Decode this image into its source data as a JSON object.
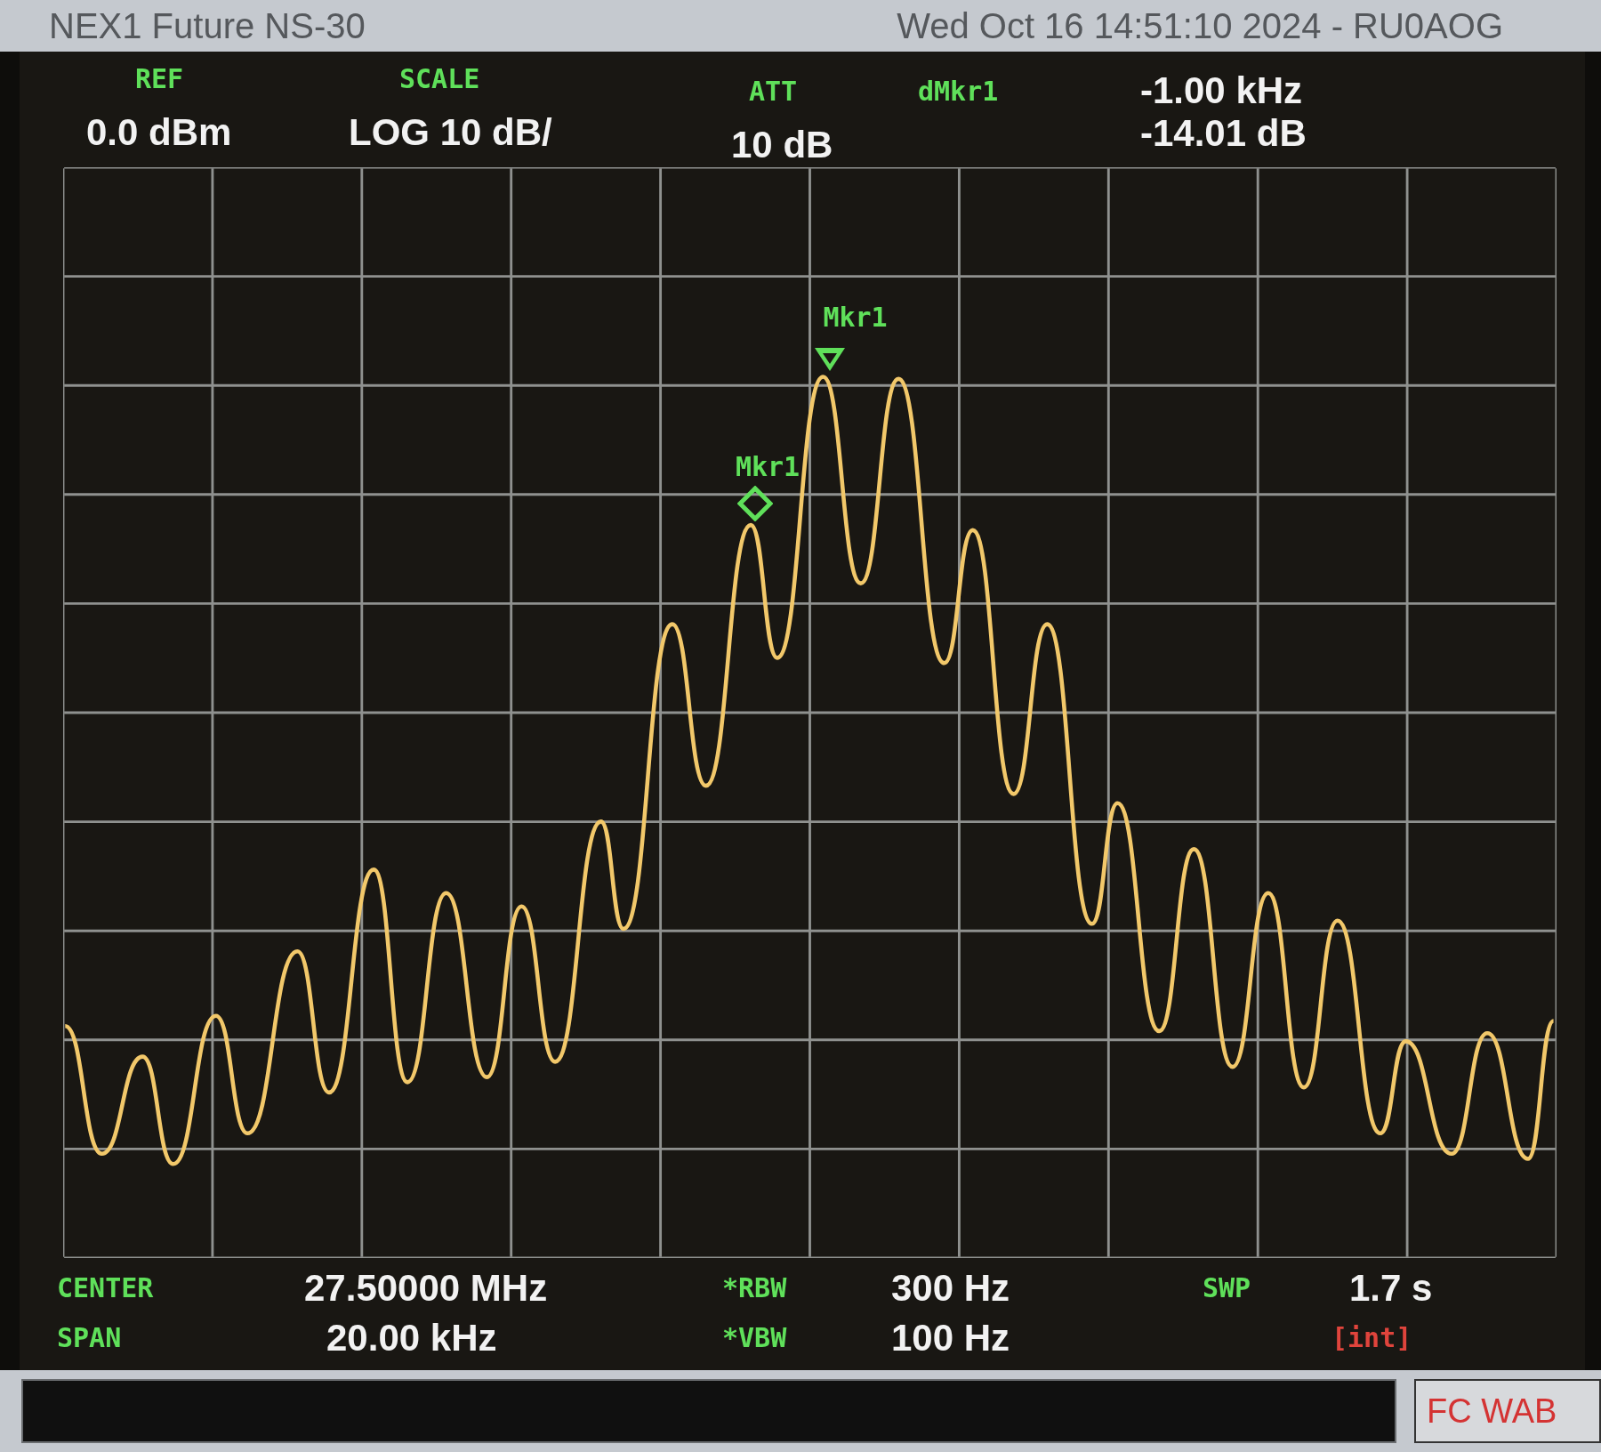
{
  "title_bar": {
    "instrument": "NEX1 Future NS-30",
    "datetime": "Wed Oct 16 14:51:10 2024 - RU0AOG"
  },
  "header": {
    "ref": {
      "label": "REF",
      "value": "0.0 dBm"
    },
    "scale": {
      "label": "SCALE",
      "value": "LOG 10 dB/"
    },
    "att": {
      "label": "ATT",
      "value": "10 dB"
    },
    "delta_marker": {
      "label": "dMkr1",
      "frequency": "-1.00 kHz",
      "amplitude": "-14.01 dB"
    }
  },
  "markers": [
    {
      "label": "Mkr1",
      "kind": "triangle"
    },
    {
      "label": "Mkr1",
      "kind": "diamond"
    }
  ],
  "footer": {
    "center": {
      "label": "CENTER",
      "value": "27.50000 MHz"
    },
    "span": {
      "label": "SPAN",
      "value": "20.00 kHz"
    },
    "rbw": {
      "label": "*RBW",
      "value": "300 Hz"
    },
    "vbw": {
      "label": "*VBW",
      "value": "100 Hz"
    },
    "sweep": {
      "label": "SWP",
      "value": "1.7 s",
      "mode": "[int]"
    }
  },
  "status_bar": {
    "message": "FC WAB"
  }
}
